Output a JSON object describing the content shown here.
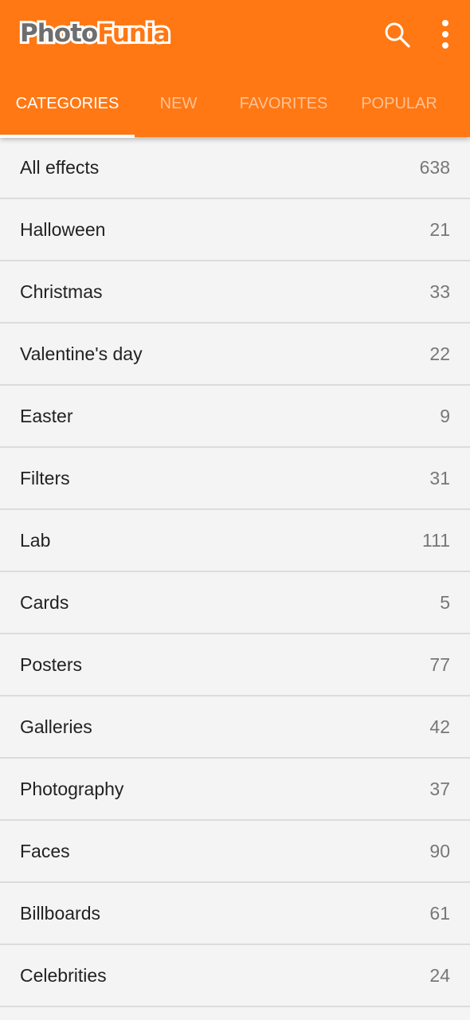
{
  "app": {
    "logo_part1": "Photo",
    "logo_part2": "Funia",
    "brand_color": "#ff7814"
  },
  "toolbar": {
    "search_icon": "search-icon",
    "more_icon": "more-vert-icon"
  },
  "tabs": [
    {
      "label": "CATEGORIES",
      "active": true
    },
    {
      "label": "NEW"
    },
    {
      "label": "FAVORITES"
    },
    {
      "label": "POPULAR"
    }
  ],
  "categories": [
    {
      "label": "All effects",
      "count": "638"
    },
    {
      "label": "Halloween",
      "count": "21"
    },
    {
      "label": "Christmas",
      "count": "33"
    },
    {
      "label": "Valentine's day",
      "count": "22"
    },
    {
      "label": "Easter",
      "count": "9"
    },
    {
      "label": "Filters",
      "count": "31"
    },
    {
      "label": "Lab",
      "count": "111"
    },
    {
      "label": "Cards",
      "count": "5"
    },
    {
      "label": "Posters",
      "count": "77"
    },
    {
      "label": "Galleries",
      "count": "42"
    },
    {
      "label": "Photography",
      "count": "37"
    },
    {
      "label": "Faces",
      "count": "90"
    },
    {
      "label": "Billboards",
      "count": "61"
    },
    {
      "label": "Celebrities",
      "count": "24"
    }
  ]
}
